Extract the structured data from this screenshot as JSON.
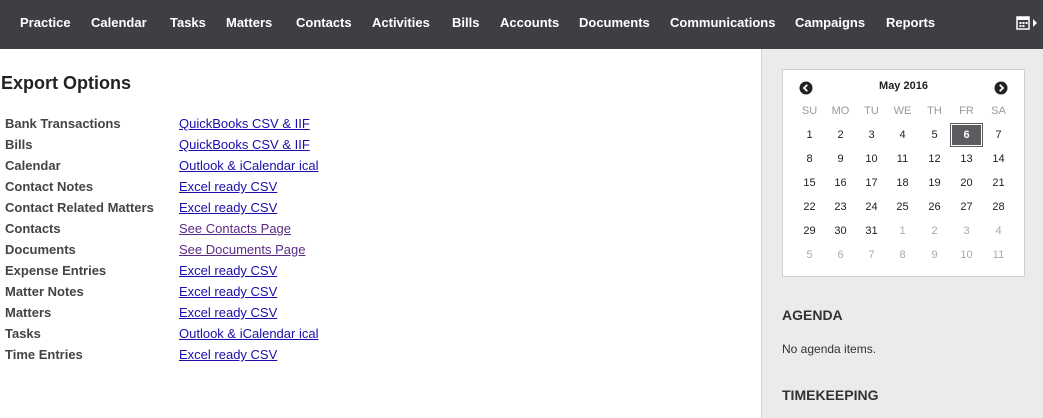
{
  "nav": {
    "items": [
      {
        "label": "Practice"
      },
      {
        "label": "Calendar"
      },
      {
        "label": "Tasks"
      },
      {
        "label": "Matters"
      },
      {
        "label": "Contacts"
      },
      {
        "label": "Activities"
      },
      {
        "label": "Bills"
      },
      {
        "label": "Accounts"
      },
      {
        "label": "Documents"
      },
      {
        "label": "Communications"
      },
      {
        "label": "Campaigns"
      },
      {
        "label": "Reports"
      }
    ],
    "calendar_icon": "calendar-icon"
  },
  "main": {
    "title": "Export Options",
    "rows": [
      {
        "label": "Bank Transactions",
        "link": "QuickBooks CSV & IIF"
      },
      {
        "label": "Bills",
        "link": "QuickBooks CSV & IIF"
      },
      {
        "label": "Calendar",
        "link": "Outlook & iCalendar ical"
      },
      {
        "label": "Contact Notes",
        "link": "Excel ready CSV"
      },
      {
        "label": "Contact Related Matters",
        "link": "Excel ready CSV"
      },
      {
        "label": "Contacts",
        "link": "See Contacts Page"
      },
      {
        "label": "Documents",
        "link": "See Documents Page"
      },
      {
        "label": "Expense Entries",
        "link": "Excel ready CSV"
      },
      {
        "label": "Matter Notes",
        "link": "Excel ready CSV"
      },
      {
        "label": "Matters",
        "link": "Excel ready CSV"
      },
      {
        "label": "Tasks",
        "link": "Outlook & iCalendar ical"
      },
      {
        "label": "Time Entries",
        "link": "Excel ready CSV"
      }
    ],
    "link_color": "#1a0dab",
    "visited_link_color": "#5b2a86"
  },
  "sidebar": {
    "calendar": {
      "month": "May 2016",
      "prev_icon": "chevron-left-circle-icon",
      "next_icon": "chevron-right-circle-icon",
      "weekdays": [
        "SU",
        "MO",
        "TU",
        "WE",
        "TH",
        "FR",
        "SA"
      ],
      "weeks": [
        [
          "1",
          "2",
          "3",
          "4",
          "5",
          "6",
          "7"
        ],
        [
          "8",
          "9",
          "10",
          "11",
          "12",
          "13",
          "14"
        ],
        [
          "15",
          "16",
          "17",
          "18",
          "19",
          "20",
          "21"
        ],
        [
          "22",
          "23",
          "24",
          "25",
          "26",
          "27",
          "28"
        ],
        [
          "29",
          "30",
          "31",
          "1",
          "2",
          "3",
          "4"
        ],
        [
          "5",
          "6",
          "7",
          "8",
          "9",
          "10",
          "11"
        ]
      ],
      "selected_day": "6"
    },
    "agenda_title": "AGENDA",
    "agenda_empty": "No agenda items.",
    "timekeeping_title": "TIMEKEEPING"
  }
}
